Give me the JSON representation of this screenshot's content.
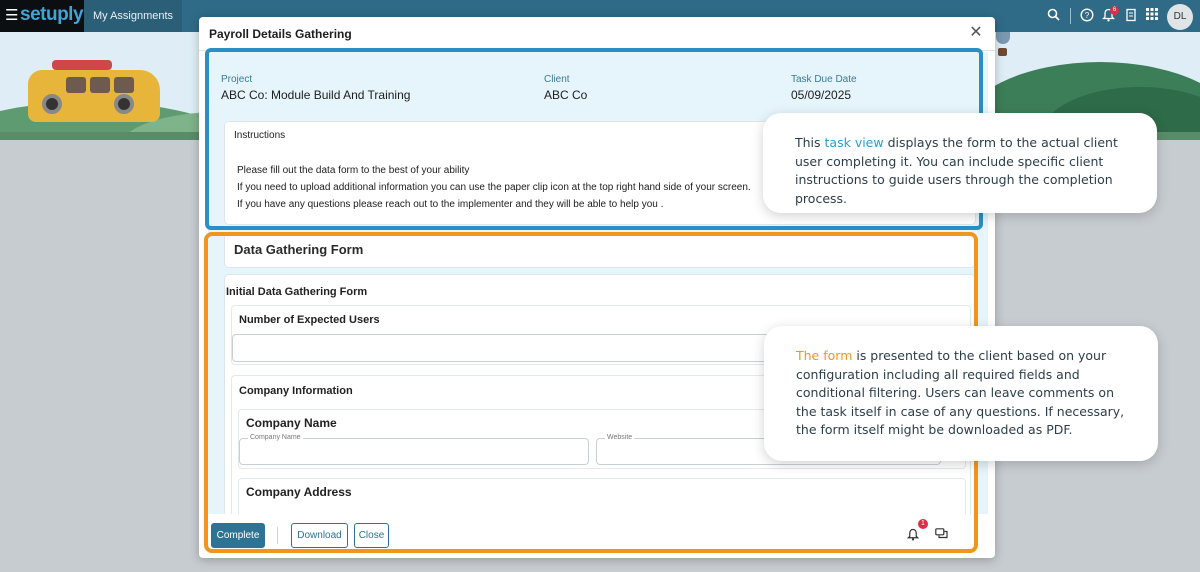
{
  "app": {
    "logo": "setuply",
    "nav_tab": "My Assignments",
    "notification_count": "6",
    "user_initials": "DL"
  },
  "icons": {
    "menu": "hamburger-icon",
    "search": "search-icon",
    "help": "help-icon",
    "bell": "bell-icon",
    "notes": "notes-icon",
    "apps": "apps-grid-icon",
    "close": "close-icon",
    "comments": "comments-icon"
  },
  "modal": {
    "title": "Payroll Details Gathering",
    "project_label": "Project",
    "project_value": "ABC Co: Module Build And Training",
    "client_label": "Client",
    "client_value": "ABC Co",
    "due_label": "Task Due Date",
    "due_value": "05/09/2025",
    "instructions": {
      "title": "Instructions",
      "lines": [
        "Please fill out the data form to the best of your ability",
        "If you need to upload additional information you can use the paper clip icon at the top right hand side of your screen.",
        "If you have any questions please reach out to the implementer and they will be able to help you ."
      ]
    },
    "form_section_title": "Data Gathering Form",
    "form": {
      "title": "Initial Data Gathering Form",
      "q_users": "Number of Expected Users",
      "users_value": "",
      "company_info": "Company Information",
      "company_name_title": "Company Name",
      "company_name_placeholder": "Company Name",
      "website_placeholder": "Website",
      "company_address_title": "Company Address"
    },
    "footer": {
      "complete": "Complete",
      "download": "Download",
      "close": "Close",
      "alert_count": "1"
    }
  },
  "callouts": {
    "task_view": {
      "pre": "This ",
      "highlight": "task view",
      "post": " displays the form to the actual client user completing it. You can include specific client instructions to guide users through the completion process."
    },
    "the_form": {
      "highlight": "The form",
      "post": " is presented to the client based on your configuration including all required fields and conditional filtering. Users can leave comments on the task itself in case of any questions. If necessary, the form itself might be downloaded as PDF."
    }
  },
  "colors": {
    "accent": "#2d7394",
    "topbar": "#2f6b86",
    "annotation_blue": "#2a8fc4",
    "annotation_orange": "#f0961d",
    "badge_red": "#d9304a"
  }
}
